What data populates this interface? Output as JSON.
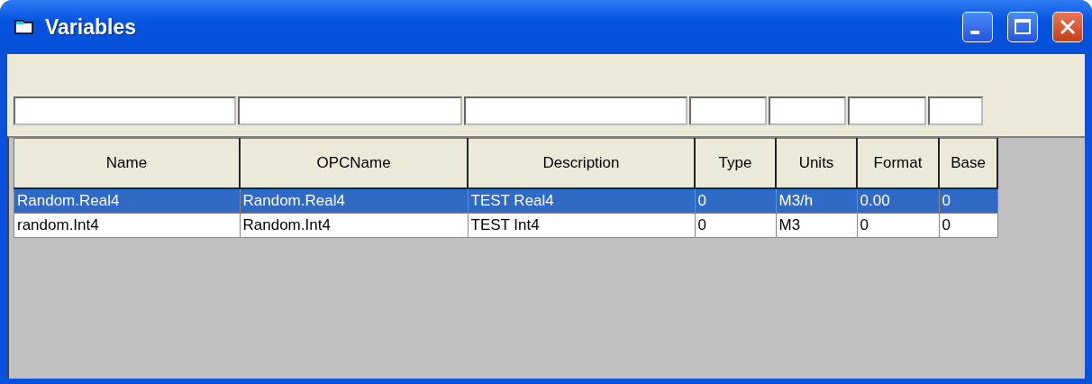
{
  "window": {
    "title": "Variables"
  },
  "table": {
    "columns": [
      "Name",
      "OPCName",
      "Description",
      "Type",
      "Units",
      "Format",
      "Base"
    ],
    "rows": [
      {
        "selected": true,
        "cells": [
          "Random.Real4",
          "Random.Real4",
          "TEST Real4",
          "0",
          "M3/h",
          "0.00",
          "0"
        ]
      },
      {
        "selected": false,
        "cells": [
          "random.Int4",
          "Random.Int4",
          "TEST Int4",
          "0",
          "M3",
          "0",
          "0"
        ]
      }
    ]
  }
}
